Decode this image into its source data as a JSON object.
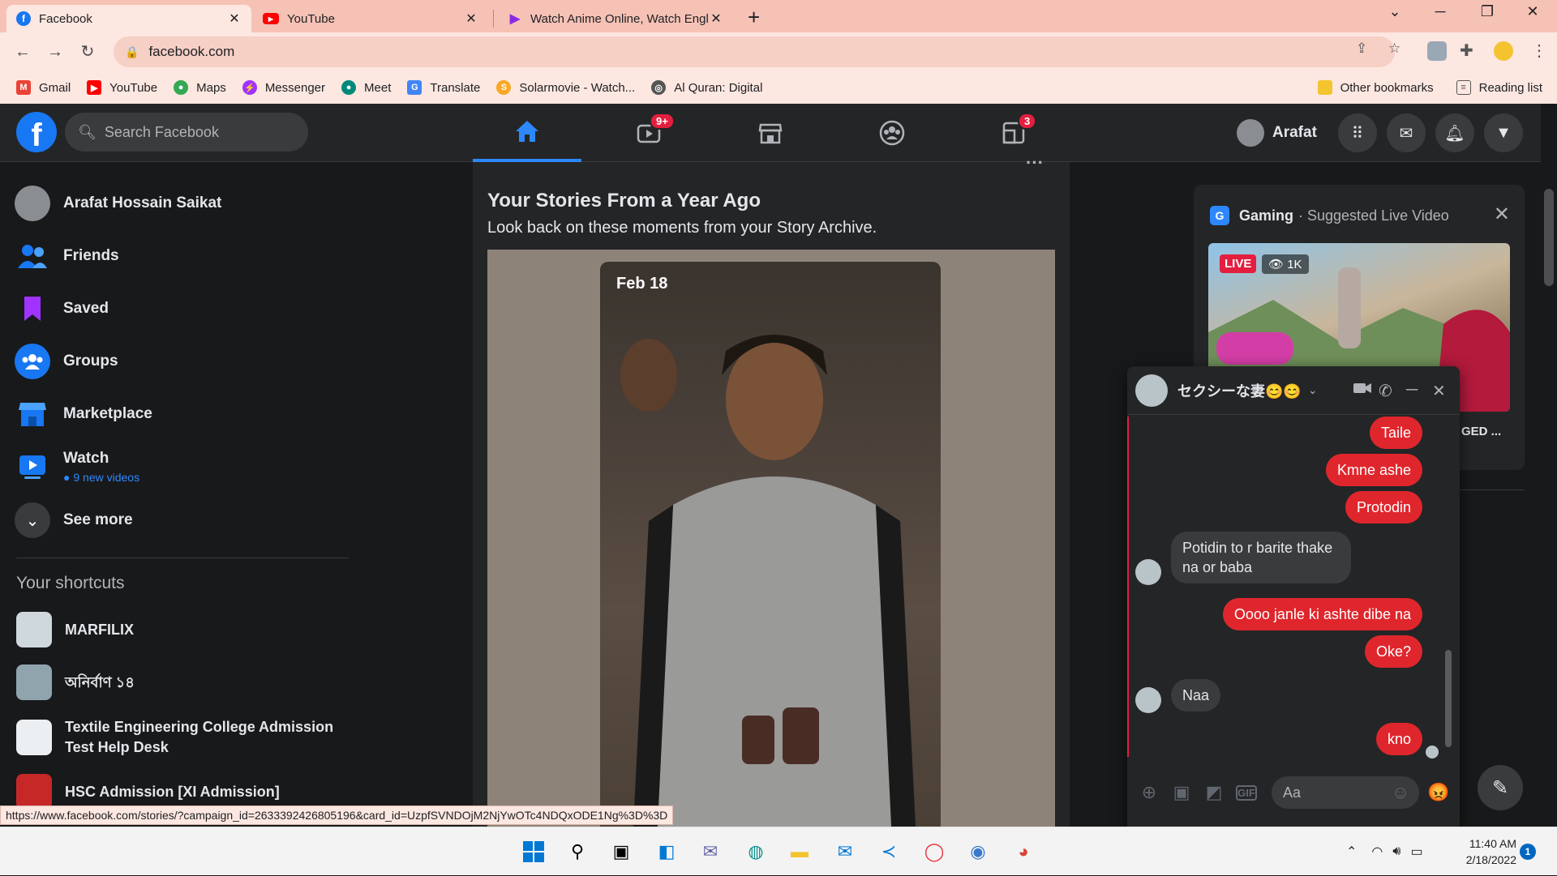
{
  "browser": {
    "tabs": [
      {
        "title": "Facebook",
        "icon": "facebook-icon",
        "color": "#1877f2"
      },
      {
        "title": "YouTube",
        "icon": "youtube-icon",
        "color": "#ff0000"
      },
      {
        "title": "Watch Anime Online, Watch Engl",
        "icon": "play-icon",
        "color": "#8a2be2"
      }
    ],
    "url": "facebook.com",
    "bookmarks": [
      {
        "label": "Gmail",
        "color": "#ea4335",
        "glyph": "M"
      },
      {
        "label": "YouTube",
        "color": "#ff0000",
        "glyph": "▶"
      },
      {
        "label": "Maps",
        "color": "#34a853",
        "glyph": "⬤"
      },
      {
        "label": "Messenger",
        "color": "#a033ff",
        "glyph": "⚡"
      },
      {
        "label": "Meet",
        "color": "#00897b",
        "glyph": "●"
      },
      {
        "label": "Translate",
        "color": "#4285f4",
        "glyph": "G"
      },
      {
        "label": "Solarmovie - Watch...",
        "color": "#f9a825",
        "glyph": "S"
      },
      {
        "label": "Al Quran: Digital",
        "color": "#555555",
        "glyph": "◎"
      }
    ],
    "other_bookmarks": "Other bookmarks",
    "reading_list": "Reading list",
    "status_link": "https://www.facebook.com/stories/?campaign_id=2633392426805196&card_id=UzpfSVNDOjM2NjYwOTc4NDQxODE1Ng%3D%3D"
  },
  "facebook": {
    "search_placeholder": "Search Facebook",
    "watch_badge": "9+",
    "notifications_badge": "3",
    "profile_name": "Arafat",
    "accent": "#2d88ff",
    "sidebar": {
      "user_name": "Arafat Hossain Saikat",
      "items": [
        {
          "label": "Friends",
          "color": "#1877f2"
        },
        {
          "label": "Saved",
          "color": "#a033ff"
        },
        {
          "label": "Groups",
          "color": "#1877f2"
        },
        {
          "label": "Marketplace",
          "color": "#1877f2"
        },
        {
          "label": "Watch",
          "color": "#1877f2",
          "sub": "9 new videos"
        }
      ],
      "see_more": "See more",
      "shortcuts_heading": "Your shortcuts",
      "shortcuts": [
        {
          "label": "MARFILIX",
          "thumb": "#cfd8dc"
        },
        {
          "label": "অনির্বাণ ১৪",
          "thumb": "#90a4ae"
        },
        {
          "label": "Textile Engineering College Admission Test Help Desk",
          "thumb": "#eceff1"
        },
        {
          "label": "HSC Admission [XI Admission]",
          "thumb": "#c62828"
        }
      ]
    },
    "story": {
      "title": "Your Stories From a Year Ago",
      "subtitle": "Look back on these moments from your Story Archive.",
      "date": "Feb 18"
    },
    "gaming": {
      "category": "Gaming",
      "suggestion": "· Suggested Live Video",
      "live_label": "LIVE",
      "viewers": "1K",
      "caption": "GED ..."
    },
    "chat": {
      "name": "セクシーな妻😊😊",
      "input_placeholder": "Aa",
      "messages": [
        {
          "from": "me",
          "text": "Taile"
        },
        {
          "from": "me",
          "text": "Kmne ashe"
        },
        {
          "from": "me",
          "text": "Protodin"
        },
        {
          "from": "them",
          "text": "Potidin to r barite thake na or baba"
        },
        {
          "from": "me",
          "text": "Oooo janle ki ashte dibe na"
        },
        {
          "from": "me",
          "text": "Oke?"
        },
        {
          "from": "them",
          "text": "Naa"
        },
        {
          "from": "me",
          "text": "kno"
        }
      ]
    }
  },
  "taskbar": {
    "time": "11:40 AM",
    "date": "2/18/2022",
    "notification_count": "1"
  }
}
